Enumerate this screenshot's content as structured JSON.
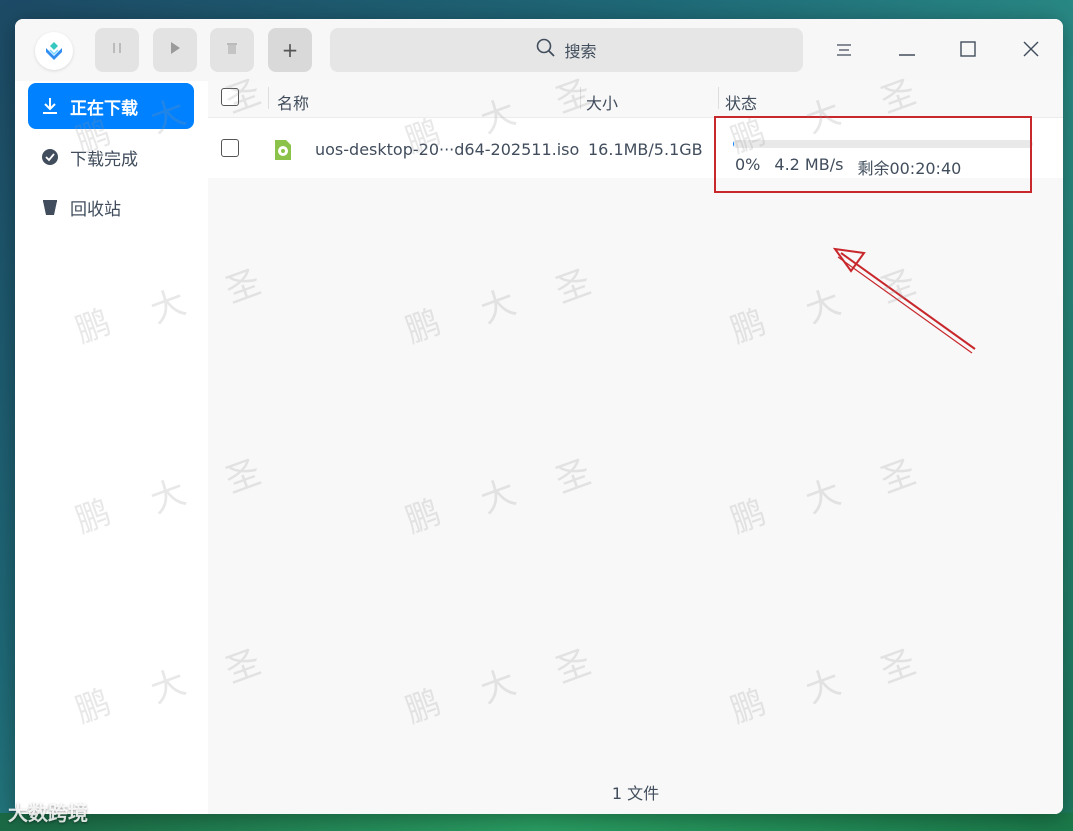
{
  "toolbar": {
    "pause_icon": "pause-icon",
    "play_icon": "play-icon",
    "delete_icon": "trash-icon",
    "add_label": "+"
  },
  "search": {
    "placeholder": "搜索"
  },
  "sidebar": {
    "items": [
      {
        "label": "正在下载",
        "icon": "download-icon",
        "active": true
      },
      {
        "label": "下载完成",
        "icon": "check-circle-icon",
        "active": false
      },
      {
        "label": "回收站",
        "icon": "trash-icon",
        "active": false
      }
    ]
  },
  "table": {
    "headers": {
      "name": "名称",
      "size": "大小",
      "status": "状态"
    },
    "rows": [
      {
        "name": "uos-desktop-20···d64-202511.iso",
        "size": "16.1MB/5.1GB",
        "progress": 0.003,
        "percent": "0%",
        "speed": "4.2 MB/s",
        "remaining": "剩余00:20:40"
      }
    ]
  },
  "footer": {
    "count": "1 文件"
  },
  "watermark": {
    "chars": [
      "鹏",
      "大",
      "圣"
    ]
  },
  "corner_logo": "大数跨境",
  "colors": {
    "accent": "#0081ff",
    "highlight": "#c8282c",
    "file_icon": "#8bc34a"
  }
}
